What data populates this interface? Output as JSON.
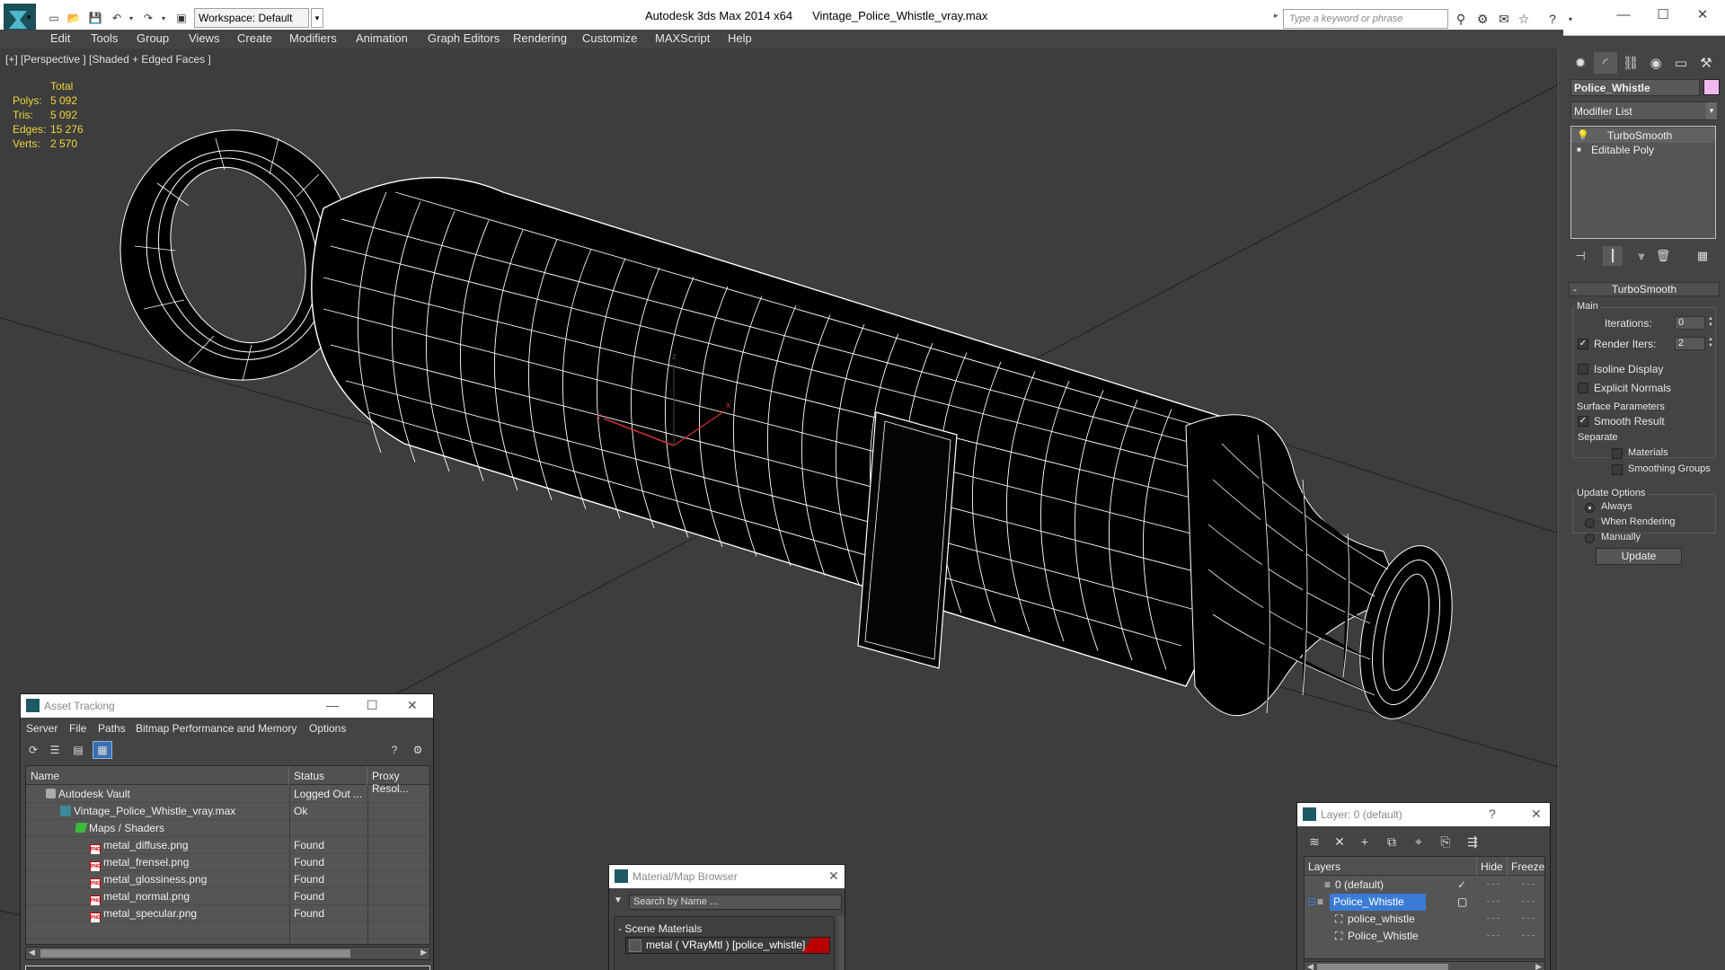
{
  "titlebar": {
    "workspace": "Workspace: Default",
    "app_title": "Autodesk 3ds Max  2014 x64",
    "file_title": "Vintage_Police_Whistle_vray.max",
    "search_placeholder": "Type a keyword or phrase"
  },
  "menubar": {
    "items": [
      "Edit",
      "Tools",
      "Group",
      "Views",
      "Create",
      "Modifiers",
      "Animation",
      "Graph Editors",
      "Rendering",
      "Customize",
      "MAXScript",
      "Help"
    ]
  },
  "viewport": {
    "label": "[+] [Perspective ] [Shaded + Edged Faces ]",
    "stats": {
      "header": "Total",
      "rows": [
        {
          "label": "Polys:",
          "value": "5 092"
        },
        {
          "label": "Tris:",
          "value": "5 092"
        },
        {
          "label": "Edges:",
          "value": "15 276"
        },
        {
          "label": "Verts:",
          "value": "2 570"
        }
      ]
    },
    "gizmo": {
      "x": "x",
      "y": "y",
      "z": "z"
    }
  },
  "command_panel": {
    "object_name": "Police_Whistle",
    "object_color": "#f0b8f0",
    "modifier_list": "Modifier List",
    "stack": [
      "TurboSmooth",
      "Editable Poly"
    ],
    "rollout": "TurboSmooth",
    "main_group": "Main",
    "iterations_label": "Iterations:",
    "iterations_value": "0",
    "render_iters_label": "Render Iters:",
    "render_iters_value": "2",
    "isoline_display": "Isoline Display",
    "explicit_normals": "Explicit Normals",
    "surface_params": "Surface Parameters",
    "smooth_result": "Smooth Result",
    "separate": "Separate",
    "materials": "Materials",
    "smoothing_groups": "Smoothing Groups",
    "update_options": "Update Options",
    "always": "Always",
    "when_rendering": "When Rendering",
    "manually": "Manually",
    "update_button": "Update"
  },
  "asset_tracking": {
    "title": "Asset Tracking",
    "menu": [
      "Server",
      "File",
      "Paths",
      "Bitmap Performance and Memory",
      "Options"
    ],
    "columns": [
      "Name",
      "Status",
      "Proxy Resol..."
    ],
    "rows": [
      {
        "name": "Autodesk Vault",
        "status": "Logged Out ...",
        "icon": "vault"
      },
      {
        "name": "Vintage_Police_Whistle_vray.max",
        "status": "Ok",
        "icon": "max"
      },
      {
        "name": "Maps / Shaders",
        "status": "",
        "icon": "maps"
      },
      {
        "name": "metal_diffuse.png",
        "status": "Found",
        "icon": "png"
      },
      {
        "name": "metal_frensel.png",
        "status": "Found",
        "icon": "png"
      },
      {
        "name": "metal_glossiness.png",
        "status": "Found",
        "icon": "png"
      },
      {
        "name": "metal_normal.png",
        "status": "Found",
        "icon": "png"
      },
      {
        "name": "metal_specular.png",
        "status": "Found",
        "icon": "png"
      }
    ]
  },
  "material_browser": {
    "title": "Material/Map Browser",
    "search_placeholder": "Search by Name ...",
    "group": "- Scene Materials",
    "item": "metal  ( VRayMtl ) [police_whistle]"
  },
  "layer_dialog": {
    "title": "Layer: 0 (default)",
    "columns": [
      "Layers",
      "Hide",
      "Freeze"
    ],
    "rows": [
      {
        "name": "0 (default)",
        "indent": 1
      },
      {
        "name": "Police_Whistle",
        "indent": 1,
        "selected": true
      },
      {
        "name": "police_whistle",
        "indent": 2
      },
      {
        "name": "Police_Whistle",
        "indent": 2
      }
    ]
  }
}
